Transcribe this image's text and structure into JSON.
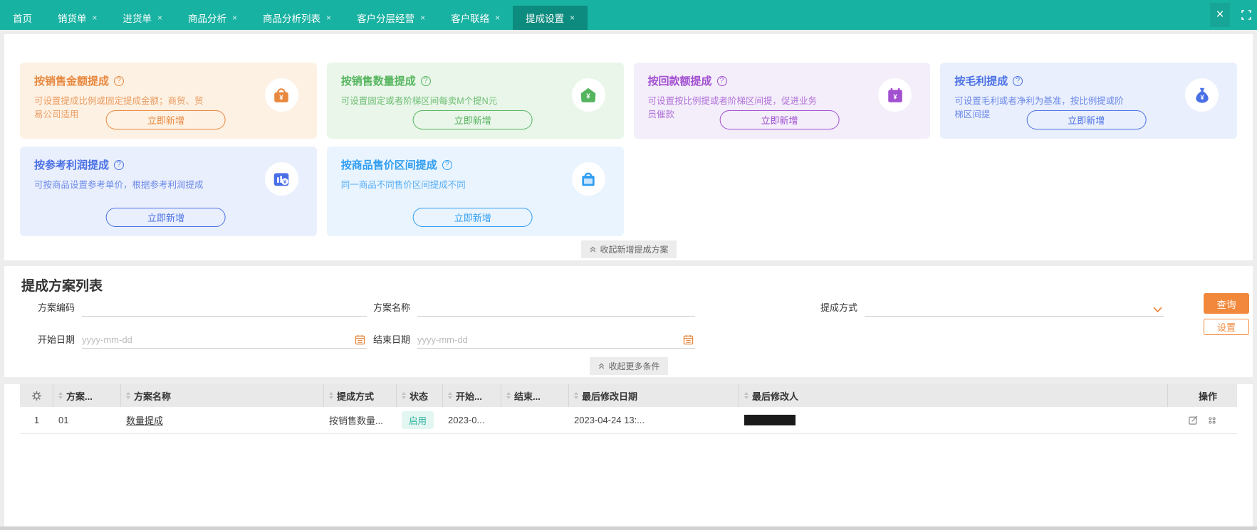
{
  "topbar": {
    "tabs": [
      {
        "label": "首页"
      },
      {
        "label": "销货单"
      },
      {
        "label": "进货单"
      },
      {
        "label": "商品分析"
      },
      {
        "label": "商品分析列表"
      },
      {
        "label": "客户分层经营"
      },
      {
        "label": "客户联络"
      },
      {
        "label": "提成设置"
      }
    ],
    "close_glyph": "×",
    "colors": {
      "bar": "#18b2a2",
      "active_tab": "#0c8b7e"
    }
  },
  "cards": [
    {
      "title": "按销售金额提成",
      "help": "?",
      "desc": "可设置提成比例或固定提成金额；商贸、贸易公司适用",
      "button": "立即新增",
      "icon": "purse-yuan-icon",
      "colors": {
        "bg": "#fdf1e3",
        "accent": "#e8883e",
        "desc": "#ec9d63"
      }
    },
    {
      "title": "按销售数量提成",
      "help": "?",
      "desc": "可设置固定或者阶梯区间每卖M个提N元",
      "button": "立即新增",
      "icon": "house-yuan-icon",
      "colors": {
        "bg": "#e9f6e9",
        "accent": "#55b55e",
        "desc": "#6fbe76"
      }
    },
    {
      "title": "按回款额提成",
      "help": "?",
      "desc": "可设置按比例提或者阶梯区间提，促进业务员催款",
      "button": "立即新增",
      "icon": "calendar-yuan-icon",
      "colors": {
        "bg": "#f3eefa",
        "accent": "#a24fd0",
        "desc": "#b271d8"
      }
    },
    {
      "title": "按毛利提成",
      "help": "?",
      "desc": "可设置毛利或者净利为基准，按比例提或阶梯区间提",
      "button": "立即新增",
      "icon": "moneybag-yuan-icon",
      "colors": {
        "bg": "#e9effc",
        "accent": "#4a70e6",
        "desc": "#6d8ae9"
      }
    },
    {
      "title": "按参考利润提成",
      "help": "?",
      "desc": "可按商品设置参考单价，根据参考利润提成",
      "button": "立即新增",
      "icon": "chart-yuan-icon",
      "colors": {
        "bg": "#e9effc",
        "accent": "#4a70e6",
        "desc": "#6d8ae9"
      }
    },
    {
      "title": "按商品售价区间提成",
      "help": "?",
      "desc": "同一商品不同售价区间提成不同",
      "button": "立即新增",
      "icon": "shopping-bag-icon",
      "colors": {
        "bg": "#e9f4fe",
        "accent": "#2f9df2",
        "desc": "#58aef4"
      }
    }
  ],
  "collapse_cards_label": "收起新增提成方案",
  "list_section": {
    "title": "提成方案列表",
    "form": {
      "code_label": "方案编码",
      "name_label": "方案名称",
      "method_label": "提成方式",
      "start_label": "开始日期",
      "end_label": "结束日期",
      "date_placeholder": "yyyy-mm-dd",
      "search_button": "查询",
      "settings_button": "设置",
      "collapse_label": "收起更多条件"
    }
  },
  "table": {
    "columns": [
      "方案...",
      "方案名称",
      "提成方式",
      "状态",
      "开始...",
      "结束...",
      "最后修改日期",
      "最后修改人",
      "操作"
    ],
    "rows": [
      {
        "index": "1",
        "code": "01",
        "name": "数量提成",
        "method": "按销售数量...",
        "status": "启用",
        "start": "2023-0...",
        "end": "",
        "modified_date": "2023-04-24 13:...",
        "modified_by_redacted": true
      }
    ],
    "status_colors": {
      "text": "#2eb3a0",
      "bg": "#e3f6f2"
    }
  }
}
